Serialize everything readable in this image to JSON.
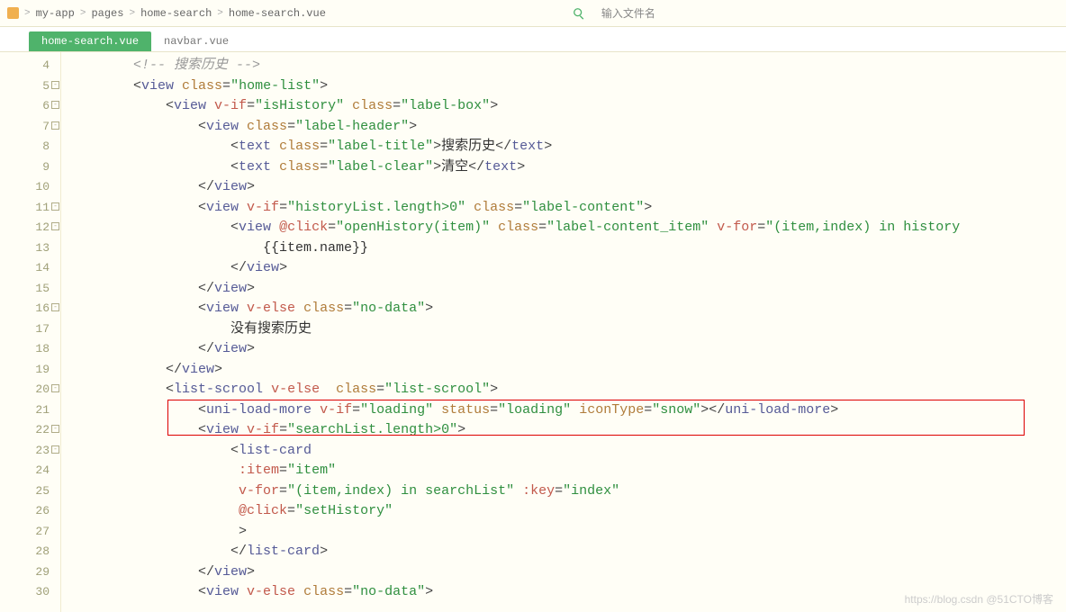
{
  "breadcrumb": {
    "seg1": "my-app",
    "seg2": "pages",
    "seg3": "home-search",
    "seg4": "home-search.vue"
  },
  "topbar": {
    "filename_placeholder": "输入文件名"
  },
  "tabs": {
    "active": "home-search.vue",
    "inactive": "navbar.vue"
  },
  "gutter": {
    "start": 4,
    "end": 30,
    "folds": [
      5,
      6,
      7,
      11,
      12,
      16,
      20,
      22,
      23
    ]
  },
  "code": [
    [
      [
        "comment",
        "<!-- 搜索历史 -->"
      ]
    ],
    [
      [
        "punc",
        "<"
      ],
      [
        "tag",
        "view "
      ],
      [
        "attr",
        "class"
      ],
      [
        "punc",
        "="
      ],
      [
        "str",
        "\"home-list\""
      ],
      [
        "punc",
        ">"
      ]
    ],
    [
      [
        "pad",
        "    "
      ],
      [
        "punc",
        "<"
      ],
      [
        "tag",
        "view "
      ],
      [
        "dir",
        "v-if"
      ],
      [
        "punc",
        "="
      ],
      [
        "str",
        "\"isHistory\""
      ],
      [
        "text",
        " "
      ],
      [
        "attr",
        "class"
      ],
      [
        "punc",
        "="
      ],
      [
        "str",
        "\"label-box\""
      ],
      [
        "punc",
        ">"
      ]
    ],
    [
      [
        "pad",
        "        "
      ],
      [
        "punc",
        "<"
      ],
      [
        "tag",
        "view "
      ],
      [
        "attr",
        "class"
      ],
      [
        "punc",
        "="
      ],
      [
        "str",
        "\"label-header\""
      ],
      [
        "punc",
        ">"
      ]
    ],
    [
      [
        "pad",
        "            "
      ],
      [
        "punc",
        "<"
      ],
      [
        "tag",
        "text "
      ],
      [
        "attr",
        "class"
      ],
      [
        "punc",
        "="
      ],
      [
        "str",
        "\"label-title\""
      ],
      [
        "punc",
        ">"
      ],
      [
        "text",
        "搜索历史"
      ],
      [
        "punc",
        "</"
      ],
      [
        "tag",
        "text"
      ],
      [
        "punc",
        ">"
      ]
    ],
    [
      [
        "pad",
        "            "
      ],
      [
        "punc",
        "<"
      ],
      [
        "tag",
        "text "
      ],
      [
        "attr",
        "class"
      ],
      [
        "punc",
        "="
      ],
      [
        "str",
        "\"label-clear\""
      ],
      [
        "punc",
        ">"
      ],
      [
        "text",
        "清空"
      ],
      [
        "punc",
        "</"
      ],
      [
        "tag",
        "text"
      ],
      [
        "punc",
        ">"
      ]
    ],
    [
      [
        "pad",
        "        "
      ],
      [
        "punc",
        "</"
      ],
      [
        "tag",
        "view"
      ],
      [
        "punc",
        ">"
      ]
    ],
    [
      [
        "pad",
        "        "
      ],
      [
        "punc",
        "<"
      ],
      [
        "tag",
        "view "
      ],
      [
        "dir",
        "v-if"
      ],
      [
        "punc",
        "="
      ],
      [
        "str",
        "\"historyList.length>0\""
      ],
      [
        "text",
        " "
      ],
      [
        "attr",
        "class"
      ],
      [
        "punc",
        "="
      ],
      [
        "str",
        "\"label-content\""
      ],
      [
        "punc",
        ">"
      ]
    ],
    [
      [
        "pad",
        "            "
      ],
      [
        "punc",
        "<"
      ],
      [
        "tag",
        "view "
      ],
      [
        "dir",
        "@click"
      ],
      [
        "punc",
        "="
      ],
      [
        "str",
        "\"openHistory(item)\""
      ],
      [
        "text",
        " "
      ],
      [
        "attr",
        "class"
      ],
      [
        "punc",
        "="
      ],
      [
        "str",
        "\"label-content_item\""
      ],
      [
        "text",
        " "
      ],
      [
        "dir",
        "v-for"
      ],
      [
        "punc",
        "="
      ],
      [
        "str",
        "\"(item,index) in history"
      ]
    ],
    [
      [
        "pad",
        "                "
      ],
      [
        "text",
        "{{item.name}}"
      ]
    ],
    [
      [
        "pad",
        "            "
      ],
      [
        "punc",
        "</"
      ],
      [
        "tag",
        "view"
      ],
      [
        "punc",
        ">"
      ]
    ],
    [
      [
        "pad",
        "        "
      ],
      [
        "punc",
        "</"
      ],
      [
        "tag",
        "view"
      ],
      [
        "punc",
        ">"
      ]
    ],
    [
      [
        "pad",
        "        "
      ],
      [
        "punc",
        "<"
      ],
      [
        "tag",
        "view "
      ],
      [
        "dir",
        "v-else"
      ],
      [
        "text",
        " "
      ],
      [
        "attr",
        "class"
      ],
      [
        "punc",
        "="
      ],
      [
        "str",
        "\"no-data\""
      ],
      [
        "punc",
        ">"
      ]
    ],
    [
      [
        "pad",
        "            "
      ],
      [
        "text",
        "没有搜索历史"
      ]
    ],
    [
      [
        "pad",
        "        "
      ],
      [
        "punc",
        "</"
      ],
      [
        "tag",
        "view"
      ],
      [
        "punc",
        ">"
      ]
    ],
    [
      [
        "pad",
        "    "
      ],
      [
        "punc",
        "</"
      ],
      [
        "tag",
        "view"
      ],
      [
        "punc",
        ">"
      ]
    ],
    [
      [
        "pad",
        "    "
      ],
      [
        "punc",
        "<"
      ],
      [
        "tag",
        "list-scrool "
      ],
      [
        "dir",
        "v-else"
      ],
      [
        "text",
        "  "
      ],
      [
        "attr",
        "class"
      ],
      [
        "punc",
        "="
      ],
      [
        "str",
        "\"list-scrool\""
      ],
      [
        "punc",
        ">"
      ]
    ],
    [
      [
        "pad",
        "        "
      ],
      [
        "punc",
        "<"
      ],
      [
        "tag",
        "uni-load-more "
      ],
      [
        "dir",
        "v-if"
      ],
      [
        "punc",
        "="
      ],
      [
        "str",
        "\"loading\""
      ],
      [
        "text",
        " "
      ],
      [
        "attr",
        "status"
      ],
      [
        "punc",
        "="
      ],
      [
        "str",
        "\"loading\""
      ],
      [
        "text",
        " "
      ],
      [
        "attr",
        "iconType"
      ],
      [
        "punc",
        "="
      ],
      [
        "str",
        "\"snow\""
      ],
      [
        "punc",
        "></"
      ],
      [
        "tag",
        "uni-load-more"
      ],
      [
        "punc",
        ">"
      ]
    ],
    [
      [
        "pad",
        "        "
      ],
      [
        "punc",
        "<"
      ],
      [
        "tag",
        "view "
      ],
      [
        "dir",
        "v-if"
      ],
      [
        "punc",
        "="
      ],
      [
        "str",
        "\"searchList.length>0\""
      ],
      [
        "punc",
        ">"
      ]
    ],
    [
      [
        "pad",
        "            "
      ],
      [
        "punc",
        "<"
      ],
      [
        "tag",
        "list-card"
      ]
    ],
    [
      [
        "pad",
        "             "
      ],
      [
        "dir",
        ":item"
      ],
      [
        "punc",
        "="
      ],
      [
        "str",
        "\"item\""
      ]
    ],
    [
      [
        "pad",
        "             "
      ],
      [
        "dir",
        "v-for"
      ],
      [
        "punc",
        "="
      ],
      [
        "str",
        "\"(item,index) in searchList\""
      ],
      [
        "text",
        " "
      ],
      [
        "dir",
        ":key"
      ],
      [
        "punc",
        "="
      ],
      [
        "str",
        "\"index\""
      ]
    ],
    [
      [
        "pad",
        "             "
      ],
      [
        "dir",
        "@click"
      ],
      [
        "punc",
        "="
      ],
      [
        "str",
        "\"setHistory\""
      ]
    ],
    [
      [
        "pad",
        "             "
      ],
      [
        "punc",
        ">"
      ]
    ],
    [
      [
        "pad",
        "            "
      ],
      [
        "punc",
        "</"
      ],
      [
        "tag",
        "list-card"
      ],
      [
        "punc",
        ">"
      ]
    ],
    [
      [
        "pad",
        "        "
      ],
      [
        "punc",
        "</"
      ],
      [
        "tag",
        "view"
      ],
      [
        "punc",
        ">"
      ]
    ],
    [
      [
        "pad",
        "        "
      ],
      [
        "punc",
        "<"
      ],
      [
        "tag",
        "view "
      ],
      [
        "dir",
        "v-else"
      ],
      [
        "text",
        " "
      ],
      [
        "attr",
        "class"
      ],
      [
        "punc",
        "="
      ],
      [
        "str",
        "\"no-data\""
      ],
      [
        "punc",
        ">"
      ]
    ]
  ],
  "watermark": "https://blog.csdn @51CTO博客",
  "colors": {
    "bg": "#fffef6",
    "tab_active": "#4fb36b",
    "string": "#2f8f3f",
    "attr": "#b07c3a",
    "directive": "#c2594b",
    "tag": "#555a96",
    "annotation_box": "#d00"
  }
}
